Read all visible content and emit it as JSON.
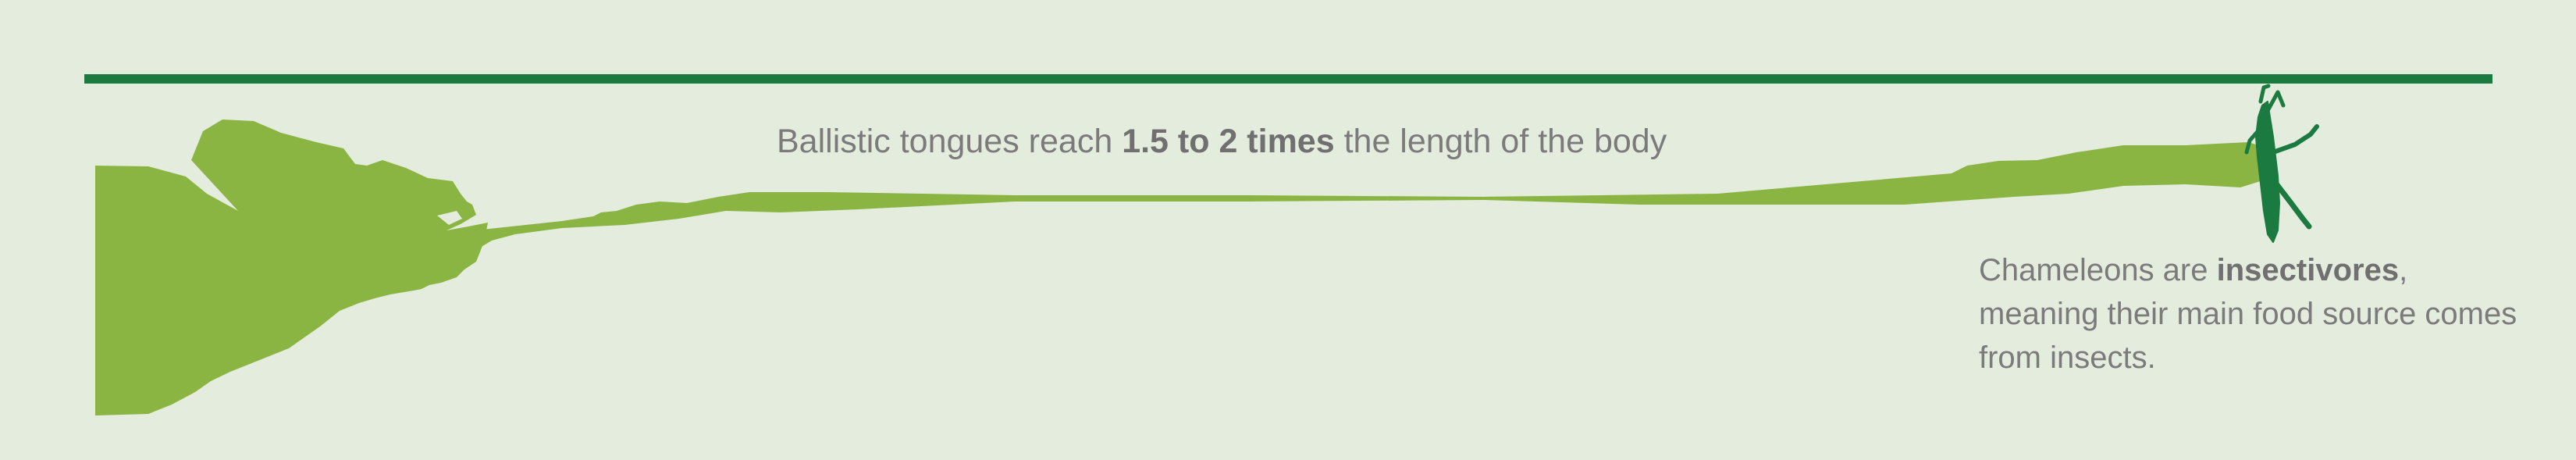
{
  "top_caption": {
    "before": "Ballistic tongues reach ",
    "bold": "1.5 to 2 times",
    "after": " the length of the body"
  },
  "side_caption": {
    "before": "Chameleons are ",
    "bold": "insectivores",
    "after": ", meaning their main food source comes from insects."
  },
  "colors": {
    "background": "#e4ecde",
    "rule": "#1a7a3f",
    "chameleon": "#8ab543",
    "insect": "#1a7a3f",
    "text": "#7b7b7b"
  },
  "icons": [
    "chameleon-silhouette-icon",
    "tongue-icon",
    "insect-icon"
  ]
}
